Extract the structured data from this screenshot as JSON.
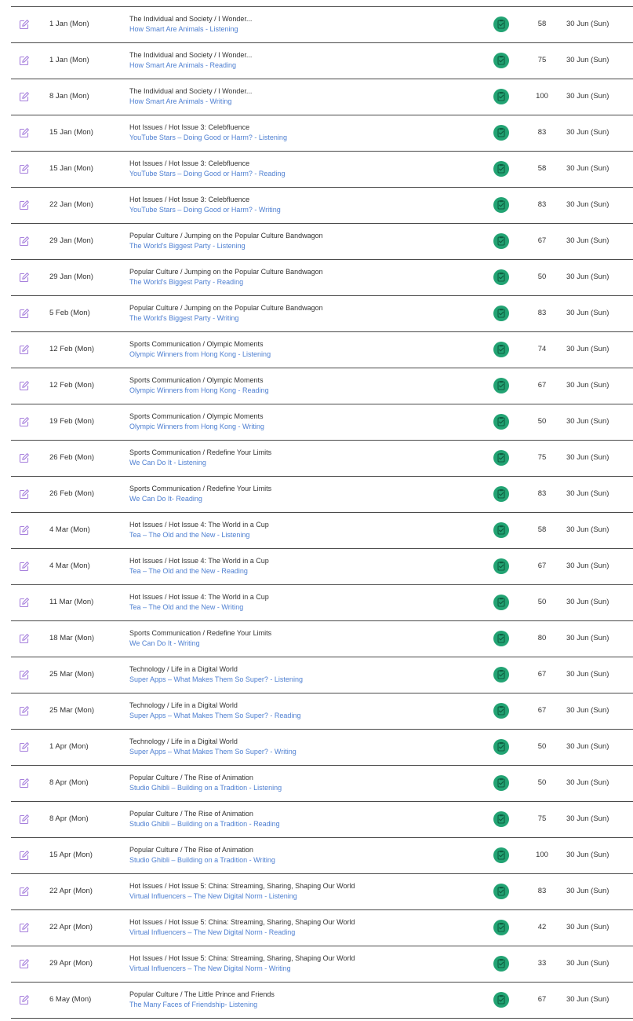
{
  "colors": {
    "task_link": "#4e7fd1",
    "edit_icon": "#a67fdc",
    "status_badge": "#22a373",
    "row_border": "#4a4a4a"
  },
  "icons": {
    "edit": "edit-icon",
    "status": "completed-status-icon"
  },
  "rows": [
    {
      "date": "1 Jan (Mon)",
      "topic": "The Individual and Society / I Wonder...",
      "task": "How Smart Are Animals - Listening",
      "score": "58",
      "due": "30 Jun (Sun)"
    },
    {
      "date": "1 Jan (Mon)",
      "topic": "The Individual and Society / I Wonder...",
      "task": "How Smart Are Animals - Reading",
      "score": "75",
      "due": "30 Jun (Sun)"
    },
    {
      "date": "8 Jan (Mon)",
      "topic": "The Individual and Society / I Wonder...",
      "task": "How Smart Are Animals - Writing",
      "score": "100",
      "due": "30 Jun (Sun)"
    },
    {
      "date": "15 Jan (Mon)",
      "topic": "Hot Issues / Hot Issue 3: Celebfluence",
      "task": "YouTube Stars – Doing Good or Harm? - Listening",
      "score": "83",
      "due": "30 Jun (Sun)"
    },
    {
      "date": "15 Jan (Mon)",
      "topic": "Hot Issues / Hot Issue 3: Celebfluence",
      "task": "YouTube Stars – Doing Good or Harm? - Reading",
      "score": "58",
      "due": "30 Jun (Sun)"
    },
    {
      "date": "22 Jan (Mon)",
      "topic": "Hot Issues / Hot Issue 3: Celebfluence",
      "task": "YouTube Stars – Doing Good or Harm? - Writing",
      "score": "83",
      "due": "30 Jun (Sun)"
    },
    {
      "date": "29 Jan (Mon)",
      "topic": "Popular Culture / Jumping on the Popular Culture Bandwagon",
      "task": "The World's Biggest Party - Listening",
      "score": "67",
      "due": "30 Jun (Sun)"
    },
    {
      "date": "29 Jan (Mon)",
      "topic": "Popular Culture / Jumping on the Popular Culture Bandwagon",
      "task": "The World's Biggest Party - Reading",
      "score": "50",
      "due": "30 Jun (Sun)"
    },
    {
      "date": "5 Feb (Mon)",
      "topic": "Popular Culture / Jumping on the Popular Culture Bandwagon",
      "task": "The World's Biggest Party - Writing",
      "score": "83",
      "due": "30 Jun (Sun)"
    },
    {
      "date": "12 Feb (Mon)",
      "topic": "Sports Communication / Olympic Moments",
      "task": "Olympic Winners from Hong Kong - Listening",
      "score": "74",
      "due": "30 Jun (Sun)"
    },
    {
      "date": "12 Feb (Mon)",
      "topic": "Sports Communication / Olympic Moments",
      "task": "Olympic Winners from Hong Kong - Reading",
      "score": "67",
      "due": "30 Jun (Sun)"
    },
    {
      "date": "19 Feb (Mon)",
      "topic": "Sports Communication / Olympic Moments",
      "task": "Olympic Winners from Hong Kong - Writing",
      "score": "50",
      "due": "30 Jun (Sun)"
    },
    {
      "date": "26 Feb (Mon)",
      "topic": "Sports Communication / Redefine Your Limits",
      "task": "We Can Do It - Listening",
      "score": "75",
      "due": "30 Jun (Sun)"
    },
    {
      "date": "26 Feb (Mon)",
      "topic": "Sports Communication / Redefine Your Limits",
      "task": "We Can Do It- Reading",
      "score": "83",
      "due": "30 Jun (Sun)"
    },
    {
      "date": "4 Mar (Mon)",
      "topic": "Hot Issues / Hot Issue 4: The World in a Cup",
      "task": "Tea – The Old and the New - Listening",
      "score": "58",
      "due": "30 Jun (Sun)"
    },
    {
      "date": "4 Mar (Mon)",
      "topic": "Hot Issues / Hot Issue 4: The World in a Cup",
      "task": "Tea – The Old and the New - Reading",
      "score": "67",
      "due": "30 Jun (Sun)"
    },
    {
      "date": "11 Mar (Mon)",
      "topic": "Hot Issues / Hot Issue 4: The World in a Cup",
      "task": "Tea – The Old and the New - Writing",
      "score": "50",
      "due": "30 Jun (Sun)"
    },
    {
      "date": "18 Mar (Mon)",
      "topic": "Sports Communication / Redefine Your Limits",
      "task": "We Can Do It - Writing",
      "score": "80",
      "due": "30 Jun (Sun)"
    },
    {
      "date": "25 Mar (Mon)",
      "topic": "Technology / Life in a Digital World",
      "task": "Super Apps – What Makes Them So Super? - Listening",
      "score": "67",
      "due": "30 Jun (Sun)"
    },
    {
      "date": "25 Mar (Mon)",
      "topic": "Technology / Life in a Digital World",
      "task": "Super Apps – What Makes Them So Super? - Reading",
      "score": "67",
      "due": "30 Jun (Sun)"
    },
    {
      "date": "1 Apr (Mon)",
      "topic": "Technology / Life in a Digital World",
      "task": "Super Apps – What Makes Them So Super? - Writing",
      "score": "50",
      "due": "30 Jun (Sun)"
    },
    {
      "date": "8 Apr (Mon)",
      "topic": "Popular Culture / The Rise of Animation",
      "task": "Studio Ghibli – Building on a Tradition - Listening",
      "score": "50",
      "due": "30 Jun (Sun)"
    },
    {
      "date": "8 Apr (Mon)",
      "topic": "Popular Culture / The Rise of Animation",
      "task": "Studio Ghibli – Building on a Tradition - Reading",
      "score": "75",
      "due": "30 Jun (Sun)"
    },
    {
      "date": "15 Apr (Mon)",
      "topic": "Popular Culture / The Rise of Animation",
      "task": "Studio Ghibli – Building on a Tradition - Writing",
      "score": "100",
      "due": "30 Jun (Sun)"
    },
    {
      "date": "22 Apr (Mon)",
      "topic": "Hot Issues / Hot Issue 5: China: Streaming, Sharing, Shaping Our World",
      "task": "Virtual Influencers – The New Digital Norm - Listening",
      "score": "83",
      "due": "30 Jun (Sun)"
    },
    {
      "date": "22 Apr (Mon)",
      "topic": "Hot Issues / Hot Issue 5: China: Streaming, Sharing, Shaping Our World",
      "task": "Virtual Influencers – The New Digital Norm - Reading",
      "score": "42",
      "due": "30 Jun (Sun)"
    },
    {
      "date": "29 Apr (Mon)",
      "topic": "Hot Issues / Hot Issue 5: China: Streaming, Sharing, Shaping Our World",
      "task": "Virtual Influencers – The New Digital Norm - Writing",
      "score": "33",
      "due": "30 Jun (Sun)"
    },
    {
      "date": "6 May (Mon)",
      "topic": "Popular Culture / The Little Prince and Friends",
      "task": "The Many Faces of Friendship- Listening",
      "score": "67",
      "due": "30 Jun (Sun)"
    }
  ]
}
